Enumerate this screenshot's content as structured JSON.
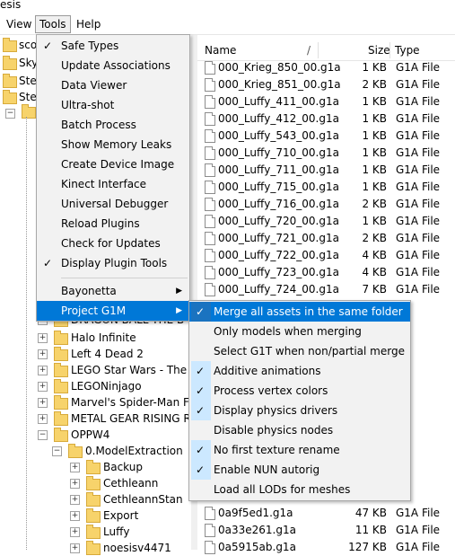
{
  "window": {
    "title_fragment": "esis"
  },
  "menubar": {
    "items": [
      "View",
      "Tools",
      "Help"
    ],
    "active": "Tools"
  },
  "tree": {
    "top_items": [
      "sco",
      "Sky",
      "Ste",
      "Ste"
    ],
    "items": [
      {
        "label": "DRAGON BALL THE B"
      },
      {
        "label": "Halo Infinite"
      },
      {
        "label": "Left 4 Dead 2"
      },
      {
        "label": "LEGO Star Wars - The S"
      },
      {
        "label": "LEGONinjago"
      },
      {
        "label": "Marvel's Spider-Man F"
      },
      {
        "label": "METAL GEAR RISING R"
      },
      {
        "label": "OPPW4"
      },
      {
        "label": "0.ModelExtraction"
      },
      {
        "label": "Backup"
      },
      {
        "label": "Cethleann"
      },
      {
        "label": "CethleannStan"
      },
      {
        "label": "Export"
      },
      {
        "label": "Luffy"
      },
      {
        "label": "noesisv4471"
      }
    ]
  },
  "filelist": {
    "headers": {
      "name": "Name",
      "sort_glyph": "/",
      "size": "Size",
      "type": "Type"
    },
    "rows": [
      {
        "name": "000_Krieg_850_00.g1a",
        "size": "1 KB",
        "type": "G1A File"
      },
      {
        "name": "000_Krieg_851_00.g1a",
        "size": "2 KB",
        "type": "G1A File"
      },
      {
        "name": "000_Luffy_411_00.g1a",
        "size": "1 KB",
        "type": "G1A File"
      },
      {
        "name": "000_Luffy_412_00.g1a",
        "size": "1 KB",
        "type": "G1A File"
      },
      {
        "name": "000_Luffy_543_00.g1a",
        "size": "1 KB",
        "type": "G1A File"
      },
      {
        "name": "000_Luffy_710_00.g1a",
        "size": "1 KB",
        "type": "G1A File"
      },
      {
        "name": "000_Luffy_711_00.g1a",
        "size": "1 KB",
        "type": "G1A File"
      },
      {
        "name": "000_Luffy_715_00.g1a",
        "size": "1 KB",
        "type": "G1A File"
      },
      {
        "name": "000_Luffy_716_00.g1a",
        "size": "2 KB",
        "type": "G1A File"
      },
      {
        "name": "000_Luffy_720_00.g1a",
        "size": "1 KB",
        "type": "G1A File"
      },
      {
        "name": "000_Luffy_721_00.g1a",
        "size": "2 KB",
        "type": "G1A File"
      },
      {
        "name": "000_Luffy_722_00.g1a",
        "size": "4 KB",
        "type": "G1A File"
      },
      {
        "name": "000_Luffy_723_00.g1a",
        "size": "4 KB",
        "type": "G1A File"
      },
      {
        "name": "000_Luffy_724_00.g1a",
        "size": "7 KB",
        "type": "G1A File"
      }
    ],
    "bottom_rows": [
      {
        "name": "0a9f5ed1.g1a",
        "size": "47 KB",
        "type": "G1A File"
      },
      {
        "name": "0a33e261.g1a",
        "size": "11 KB",
        "type": "G1A File"
      },
      {
        "name": "0a5915ab.g1a",
        "size": "127 KB",
        "type": "G1A File"
      }
    ]
  },
  "tools_menu": {
    "items": [
      {
        "label": "Safe Types",
        "checked": true
      },
      {
        "label": "Update Associations",
        "checked": false
      },
      {
        "label": "Data Viewer",
        "checked": false
      },
      {
        "label": "Ultra-shot",
        "checked": false
      },
      {
        "label": "Batch Process",
        "checked": false
      },
      {
        "label": "Show Memory Leaks",
        "checked": false
      },
      {
        "label": "Create Device Image",
        "checked": false
      },
      {
        "label": "Kinect Interface",
        "checked": false
      },
      {
        "label": "Universal Debugger",
        "checked": false
      },
      {
        "label": "Reload Plugins",
        "checked": false
      },
      {
        "label": "Check for Updates",
        "checked": false
      },
      {
        "label": "Display Plugin Tools",
        "checked": true
      }
    ],
    "submenus": [
      {
        "label": "Bayonetta",
        "arrow": "▶"
      },
      {
        "label": "Project G1M",
        "arrow": "▶",
        "highlighted": true
      }
    ]
  },
  "g1m_menu": {
    "items": [
      {
        "label": "Merge all assets in the same folder",
        "checked": true,
        "highlighted": true
      },
      {
        "label": "Only models when merging",
        "checked": false
      },
      {
        "label": "Select G1T when non/partial merge",
        "checked": false
      },
      {
        "label": "Additive animations",
        "checked": true
      },
      {
        "label": "Process vertex colors",
        "checked": true
      },
      {
        "label": "Display physics drivers",
        "checked": true
      },
      {
        "label": "Disable physics nodes",
        "checked": false
      },
      {
        "label": "No first texture rename",
        "checked": true
      },
      {
        "label": "Enable NUN autorig",
        "checked": true
      },
      {
        "label": "Load all LODs for meshes",
        "checked": false
      }
    ]
  },
  "colors": {
    "accent": "#0078d7",
    "check_bg": "#cce8ff",
    "folder": "#f7d36b"
  },
  "icons": {
    "check": "✓",
    "submenu_arrow": "▶",
    "expand": "+",
    "collapse": "−"
  }
}
